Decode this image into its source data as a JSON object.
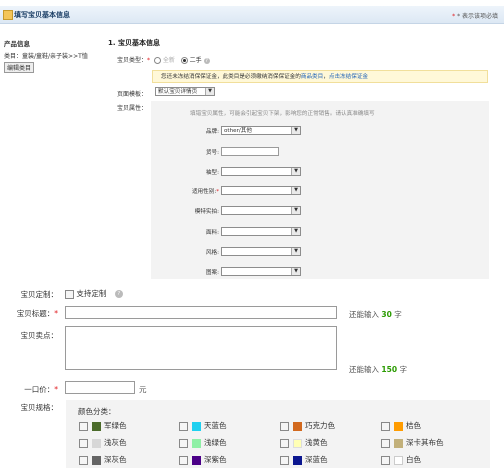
{
  "header": {
    "title": "填写宝贝基本信息",
    "required_note": "* 表示该项必填"
  },
  "product_info": {
    "heading": "产品信息",
    "category_line1": "类目：童装/童鞋/亲子装>>T恤",
    "edit_button": "编辑类目"
  },
  "section": {
    "title": "1. 宝贝基本信息"
  },
  "item_type": {
    "label": "宝贝类型：",
    "required": "*",
    "opt_new": "全新",
    "opt_used": "二手"
  },
  "notice": {
    "text": "您还未冻结消保保证金，此类目是必须缴纳消保保证金的",
    "link1": "商品类目",
    "link2": "点击冻结保证金"
  },
  "template": {
    "label": "页面模板：",
    "value": "默认宝贝详情页"
  },
  "attributes": {
    "label": "宝贝属性：",
    "hint": "填错宝贝属性，可能会引起宝贝下架，影响您的正常销售。请认真准确填写",
    "rows": [
      {
        "label": "品牌:",
        "value": "other/其他",
        "required": ""
      },
      {
        "label": "货号:",
        "value": "",
        "required": ""
      },
      {
        "label": "袖型:",
        "value": "",
        "required": ""
      },
      {
        "label": "适用性别:",
        "value": "",
        "required": "*"
      },
      {
        "label": "模特实拍:",
        "value": "",
        "required": ""
      },
      {
        "label": "面料:",
        "value": "",
        "required": ""
      },
      {
        "label": "风格:",
        "value": "",
        "required": ""
      },
      {
        "label": "图案:",
        "value": "",
        "required": ""
      }
    ]
  },
  "custom": {
    "label": "宝贝定制：",
    "checkbox_label": "支持定制"
  },
  "title_field": {
    "label": "宝贝标题：",
    "required": "*",
    "counter_prefix": "还能输入",
    "counter_value": "30",
    "counter_suffix": "字"
  },
  "selling_points": {
    "label": "宝贝卖点：",
    "counter_prefix": "还能输入",
    "counter_value": "150",
    "counter_suffix": "字"
  },
  "price": {
    "label": "一口价：",
    "required": "*",
    "unit": "元"
  },
  "spec": {
    "label": "宝贝规格：",
    "color_category": "颜色分类：",
    "colors": [
      {
        "name": "军绿色",
        "color": "#4b6b2a"
      },
      {
        "name": "天蓝色",
        "color": "#1fd0f0"
      },
      {
        "name": "巧克力色",
        "color": "#d2691e"
      },
      {
        "name": "桔色",
        "color": "#ff9c00"
      },
      {
        "name": "浅灰色",
        "color": "#d7d7d7"
      },
      {
        "name": "浅绿色",
        "color": "#8ff0a6"
      },
      {
        "name": "浅黄色",
        "color": "#ffffb5"
      },
      {
        "name": "深卡其布色",
        "color": "#c2b07a"
      },
      {
        "name": "深灰色",
        "color": "#646464"
      },
      {
        "name": "深紫色",
        "color": "#4b0087"
      },
      {
        "name": "深蓝色",
        "color": "#0b168f"
      },
      {
        "name": "白色",
        "color": "#ffffff"
      }
    ]
  }
}
